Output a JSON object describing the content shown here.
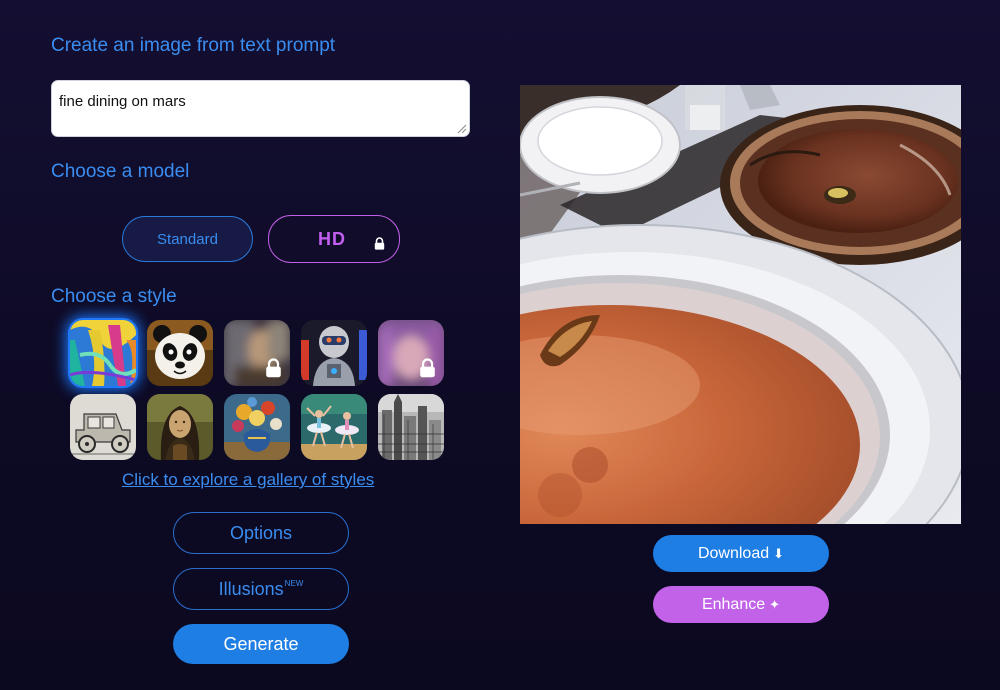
{
  "headings": {
    "create": "Create an image from text prompt",
    "model": "Choose a model",
    "style": "Choose a style"
  },
  "prompt": {
    "value": "fine dining on mars"
  },
  "models": {
    "standard": "Standard",
    "hd": "HD",
    "hd_locked": true
  },
  "styles": [
    {
      "name": "abstract-paint",
      "selected": true,
      "locked": false
    },
    {
      "name": "panda-cartoon",
      "selected": false,
      "locked": false
    },
    {
      "name": "blurred-portrait",
      "selected": false,
      "locked": true
    },
    {
      "name": "robot",
      "selected": false,
      "locked": false
    },
    {
      "name": "blurred-face",
      "selected": false,
      "locked": true
    },
    {
      "name": "vintage-car-sketch",
      "selected": false,
      "locked": false
    },
    {
      "name": "renaissance-portrait",
      "selected": false,
      "locked": false
    },
    {
      "name": "flower-still-life",
      "selected": false,
      "locked": false
    },
    {
      "name": "ballet-dancers",
      "selected": false,
      "locked": false
    },
    {
      "name": "city-etching",
      "selected": false,
      "locked": false
    }
  ],
  "gallery_link": "Click to explore a gallery of styles",
  "buttons": {
    "options": "Options",
    "illusions": "Illusions",
    "illusions_badge": "NEW",
    "generate": "Generate",
    "download": "Download",
    "download_icon": "⬇",
    "enhance": "Enhance",
    "enhance_icon": "✦"
  },
  "colors": {
    "accent_blue": "#3a8df0",
    "button_blue": "#1f7ee3",
    "accent_purple": "#c262e8",
    "background": "#0f0c26"
  }
}
